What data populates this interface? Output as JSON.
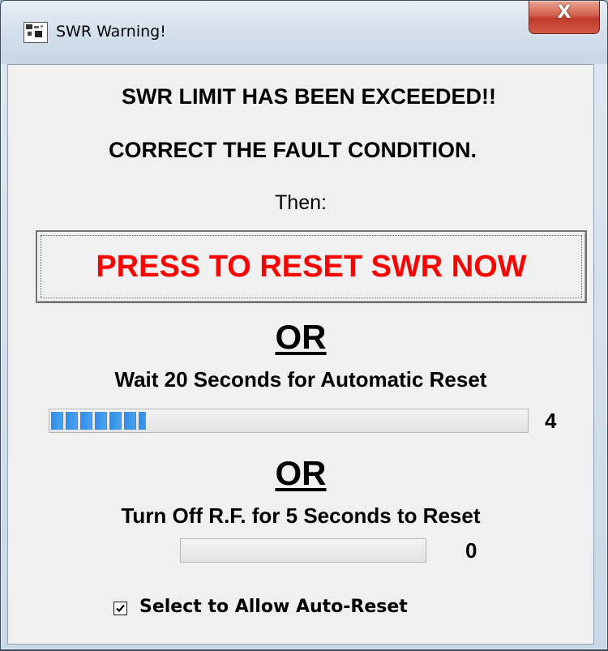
{
  "window": {
    "title": "SWR Warning!",
    "close_label": "X"
  },
  "message": {
    "line1": "SWR LIMIT HAS BEEN EXCEEDED!!",
    "line2": "CORRECT THE FAULT CONDITION.",
    "then": "Then:"
  },
  "reset_button": {
    "label": "PRESS TO RESET SWR NOW",
    "color": "#ff0000"
  },
  "or_label": "OR",
  "auto_reset": {
    "text": "Wait 20 Seconds for Automatic Reset",
    "progress_fraction": 0.2,
    "count": "4"
  },
  "rf_reset": {
    "text": "Turn Off R.F. for 5 Seconds to Reset",
    "progress_fraction": 0,
    "count": "0"
  },
  "auto_reset_checkbox": {
    "label": "Select to  Allow Auto-Reset",
    "checked": true
  },
  "colors": {
    "progress_fill": "#2f8ce6",
    "reset_text": "#ff0000"
  }
}
